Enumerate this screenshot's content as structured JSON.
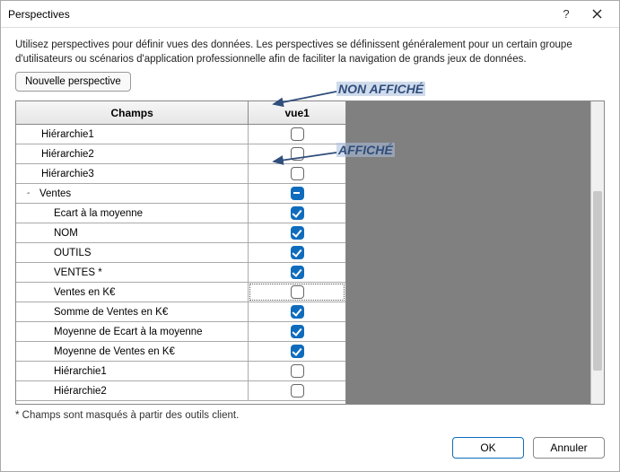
{
  "window": {
    "title": "Perspectives"
  },
  "description": "Utilisez perspectives pour définir vues des données. Les perspectives se définissent généralement pour un certain groupe d'utilisateurs ou scénarios d'application professionnelle afin de faciliter la navigation de grands jeux de données.",
  "buttons": {
    "new_perspective": "Nouvelle perspective",
    "ok": "OK",
    "cancel": "Annuler"
  },
  "columns": {
    "fields": "Champs",
    "vue1": "vue1"
  },
  "rows": [
    {
      "label": "Hiérarchie1",
      "state": "off",
      "indent": "top"
    },
    {
      "label": "Hiérarchie2",
      "state": "off",
      "indent": "top"
    },
    {
      "label": "Hiérarchie3",
      "state": "off",
      "indent": "top"
    },
    {
      "label": "Ventes",
      "state": "partial",
      "indent": "parent",
      "expander": "-"
    },
    {
      "label": "Ecart à la moyenne",
      "state": "on",
      "indent": "child"
    },
    {
      "label": "NOM",
      "state": "on",
      "indent": "child"
    },
    {
      "label": "OUTILS",
      "state": "on",
      "indent": "child"
    },
    {
      "label": "VENTES *",
      "state": "on",
      "indent": "child"
    },
    {
      "label": "Ventes en K€",
      "state": "off",
      "indent": "child",
      "selected": true
    },
    {
      "label": "Somme de Ventes en K€",
      "state": "on",
      "indent": "child"
    },
    {
      "label": "Moyenne de Ecart à la moyenne",
      "state": "on",
      "indent": "child"
    },
    {
      "label": "Moyenne de Ventes en K€",
      "state": "on",
      "indent": "child"
    },
    {
      "label": "Hiérarchie1",
      "state": "off",
      "indent": "child"
    },
    {
      "label": "Hiérarchie2",
      "state": "off",
      "indent": "child"
    }
  ],
  "footnote": "* Champs sont masqués à partir des outils client.",
  "callouts": {
    "not_shown": "NON AFFICHÉ",
    "shown": "AFFICHÉ"
  }
}
